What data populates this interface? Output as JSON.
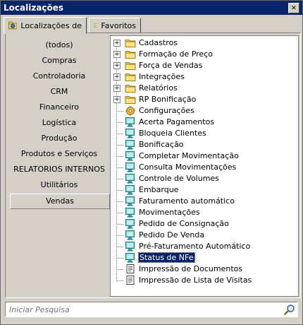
{
  "window": {
    "title": "Localizações",
    "close_symbol": "✕"
  },
  "tabs": [
    {
      "label": "Localizações de",
      "icon": "globe-folder-icon"
    },
    {
      "label": "Favoritos",
      "icon": "star-icon"
    }
  ],
  "left_panel": {
    "items": [
      {
        "label": "(todos)"
      },
      {
        "label": "Compras"
      },
      {
        "label": "Controladoria"
      },
      {
        "label": "CRM"
      },
      {
        "label": "Financeiro"
      },
      {
        "label": "Logística"
      },
      {
        "label": "Produção"
      },
      {
        "label": "Produtos e Serviços"
      },
      {
        "label": "RELATORIOS INTERNOS"
      },
      {
        "label": "Utilitários"
      },
      {
        "label": "Vendas",
        "selected": true
      }
    ]
  },
  "tree": {
    "items": [
      {
        "label": "Cadastros",
        "icon": "folder-icon",
        "expander": "+"
      },
      {
        "label": "Formação de Preço",
        "icon": "folder-icon",
        "expander": "+"
      },
      {
        "label": "Força de Vendas",
        "icon": "folder-icon",
        "expander": "+"
      },
      {
        "label": "Integrações",
        "icon": "folder-icon",
        "expander": "+"
      },
      {
        "label": "Relatórios",
        "icon": "folder-icon",
        "expander": "+"
      },
      {
        "label": "RP Bonificação",
        "icon": "folder-icon",
        "expander": "+"
      },
      {
        "label": "Configurações",
        "icon": "settings-icon"
      },
      {
        "label": "Acerta Pagamentos",
        "icon": "screen-icon"
      },
      {
        "label": "Bloqueia Clientes",
        "icon": "screen-icon"
      },
      {
        "label": "Bonificação",
        "icon": "screen-icon"
      },
      {
        "label": "Completar Movimentação",
        "icon": "screen-icon"
      },
      {
        "label": "Consulta Movimentações",
        "icon": "screen-icon"
      },
      {
        "label": "Controle de Volumes",
        "icon": "screen-icon"
      },
      {
        "label": "Embarque",
        "icon": "screen-icon"
      },
      {
        "label": "Faturamento automático",
        "icon": "screen-icon"
      },
      {
        "label": "Movimentações",
        "icon": "screen-icon"
      },
      {
        "label": "Pedido de Consignação",
        "icon": "screen-icon"
      },
      {
        "label": "Pedido De Venda",
        "icon": "screen-icon"
      },
      {
        "label": "Pré-Faturamento Automático",
        "icon": "screen-icon"
      },
      {
        "label": "Status de NFe",
        "icon": "screen-icon",
        "selected": true
      },
      {
        "label": "Impressão de Documentos",
        "icon": "report-icon"
      },
      {
        "label": "Impressão de Lista de Visitas",
        "icon": "report-icon"
      }
    ]
  },
  "search": {
    "placeholder": "Iniciar Pesquisa",
    "value": ""
  },
  "colors": {
    "titlebar": "#0A246A",
    "face": "#D4D0C8",
    "folder": "#F5D25C",
    "screen": "#3BA6A6",
    "selection": "#0A246A"
  }
}
